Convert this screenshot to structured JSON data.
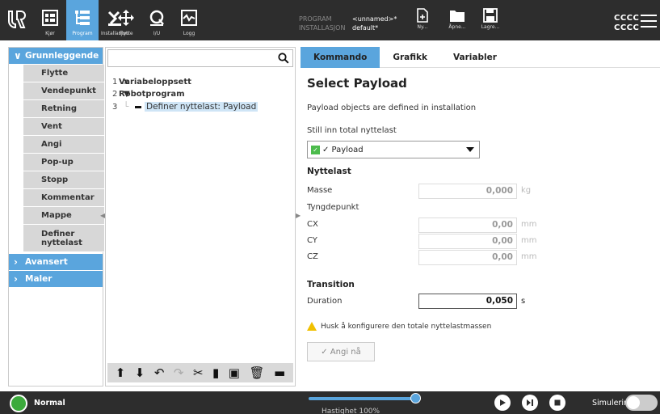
{
  "topbar": {
    "nav": [
      {
        "label": "Kjør",
        "icon": "run-icon"
      },
      {
        "label": "Program",
        "icon": "program-icon",
        "active": true
      },
      {
        "label": "Installasjon",
        "icon": "installation-icon"
      },
      {
        "label": "Flytte",
        "icon": "move-icon"
      },
      {
        "label": "I/U",
        "icon": "io-icon"
      },
      {
        "label": "Logg",
        "icon": "log-icon"
      }
    ],
    "program_key": "PROGRAM",
    "program_value": "<unnamed>*",
    "installation_key": "INSTALLASJON",
    "installation_value": "default*",
    "file_buttons": [
      {
        "label": "Ny...",
        "icon": "new-file-icon"
      },
      {
        "label": "Åpne...",
        "icon": "open-folder-icon"
      },
      {
        "label": "Lagre...",
        "icon": "save-icon"
      }
    ],
    "robot_name_1": "CCCC",
    "robot_name_2": "CCCC"
  },
  "leftnav": {
    "basic_label": "Grunnleggende",
    "items": [
      "Flytte",
      "Vendepunkt",
      "Retning",
      "Vent",
      "Angi",
      "Pop-up",
      "Stopp",
      "Kommentar",
      "Mappe"
    ],
    "last_item_line1": "Definer",
    "last_item_line2": "nyttelast",
    "advanced_label": "Avansert",
    "templates_label": "Maler"
  },
  "tree": {
    "search_placeholder": "",
    "lines": [
      {
        "num": "1",
        "icon": "x",
        "text": "Variabeloppsett"
      },
      {
        "num": "2",
        "icon": "▼",
        "text": "Robotprogram"
      },
      {
        "num": "3",
        "icon": "",
        "text": "Definer nyttelast: Payload"
      }
    ]
  },
  "right": {
    "tabs": [
      "Kommando",
      "Grafikk",
      "Variabler"
    ],
    "title": "Select Payload",
    "info": "Payload objects are defined in installation",
    "set_total_label": "Still inn total nyttelast",
    "dropdown_value": "✓ Payload",
    "payload_heading": "Nyttelast",
    "mass_label": "Masse",
    "mass_value": "0,000",
    "mass_unit": "kg",
    "cog_label": "Tyngdepunkt",
    "cx_label": "CX",
    "cx_value": "0,00",
    "cx_unit": "mm",
    "cy_label": "CY",
    "cy_value": "0,00",
    "cy_unit": "mm",
    "cz_label": "CZ",
    "cz_value": "0,00",
    "cz_unit": "mm",
    "transition_heading": "Transition",
    "duration_label": "Duration",
    "duration_value": "0,050",
    "duration_unit": "s",
    "warning": "Husk å konfigurere den totale nyttelastmassen",
    "apply_label": "✓ Angi nå"
  },
  "footer": {
    "status": "Normal",
    "speed_label": "Hastighet 100%",
    "speed_percent": 100,
    "sim_label": "Simulering",
    "sim_on": false
  }
}
